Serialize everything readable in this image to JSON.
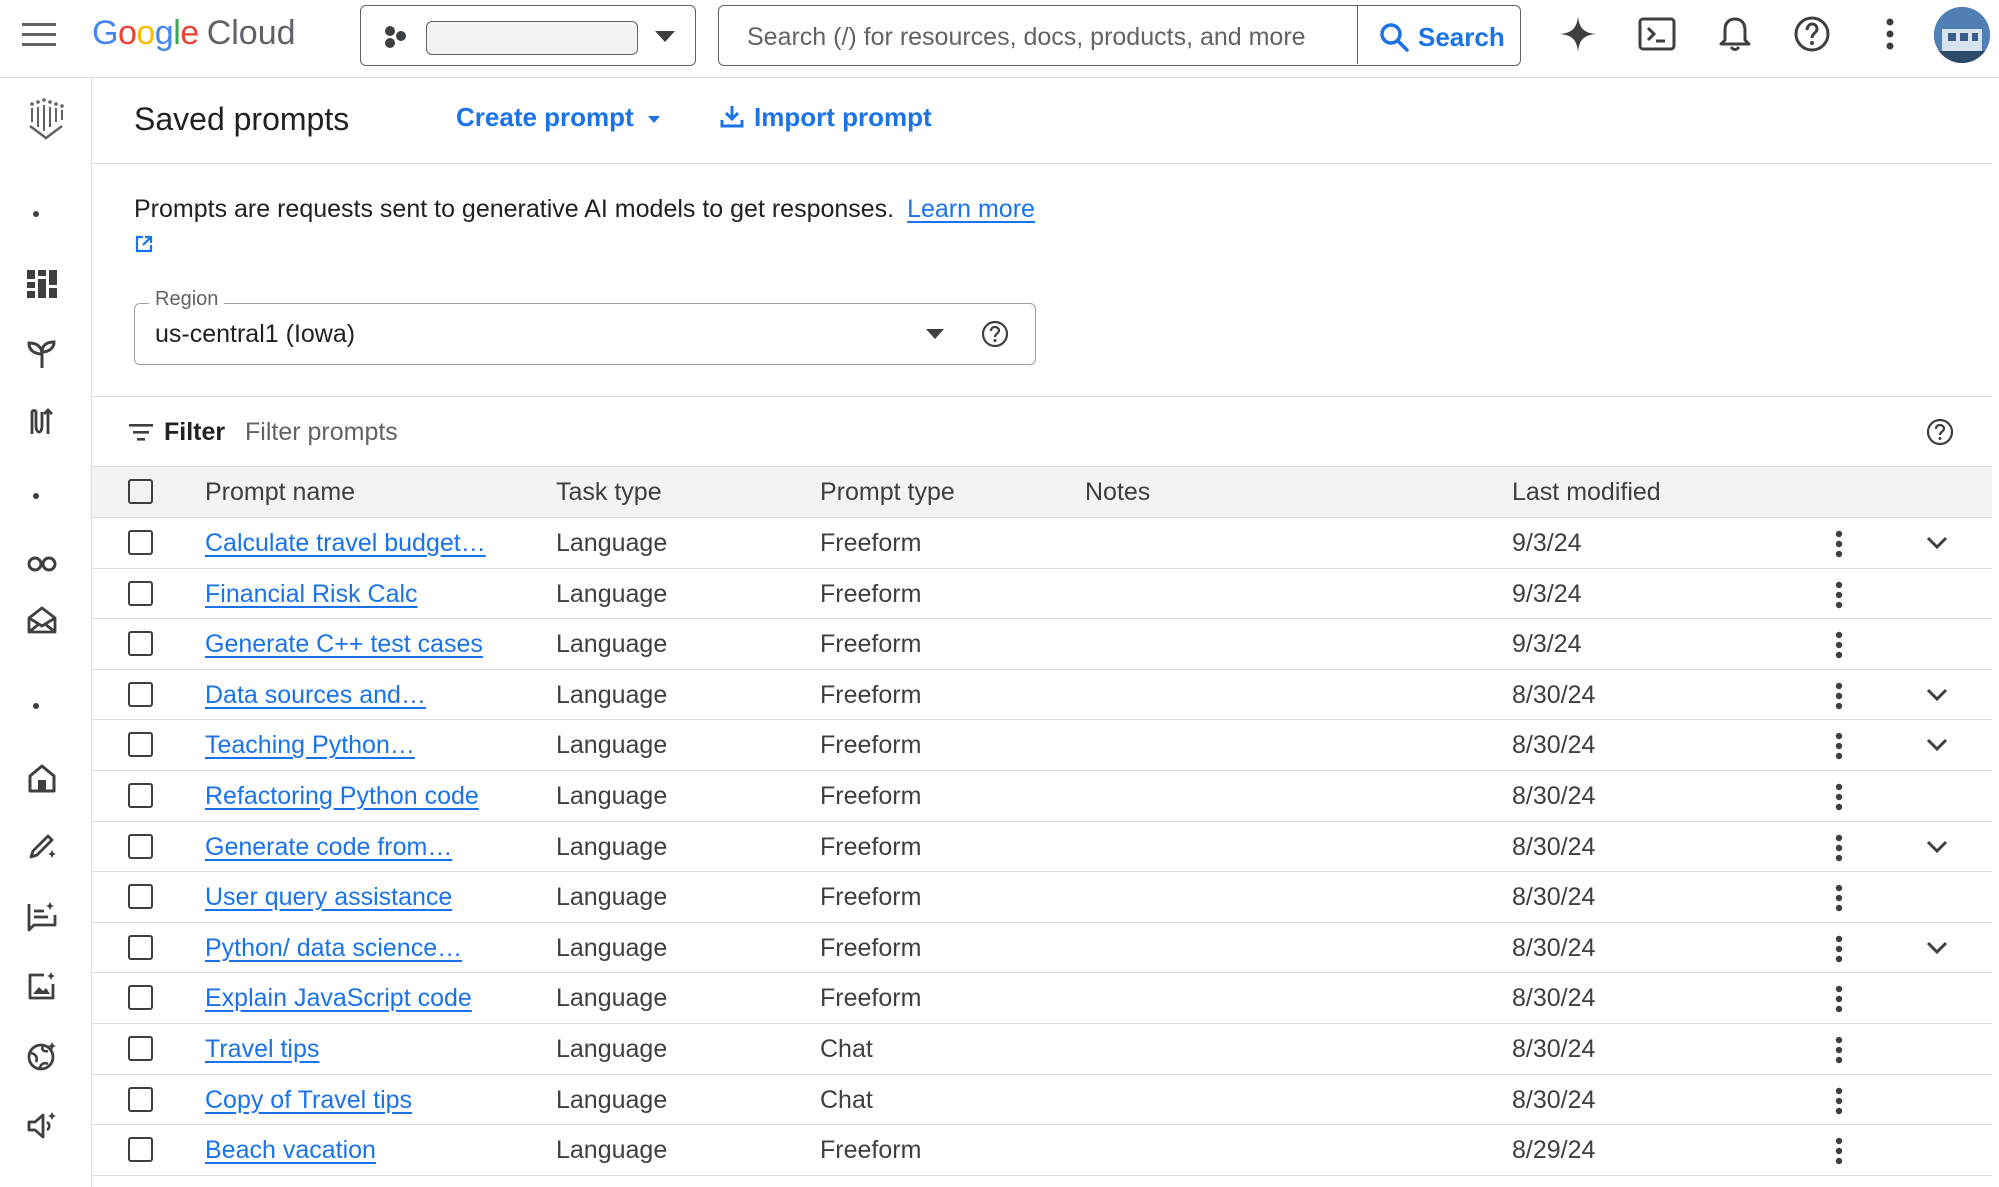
{
  "app": {
    "logo_google": "Google",
    "logo_cloud": "Cloud",
    "search_placeholder": "Search (/) for resources, docs, products, and more",
    "search_button": "Search"
  },
  "header": {
    "title": "Saved prompts",
    "create_prompt": "Create prompt",
    "import_prompt": "Import prompt"
  },
  "intro": {
    "text": "Prompts are requests sent to generative AI models to get responses.",
    "learn_more": "Learn more"
  },
  "region": {
    "label": "Region",
    "value": "us-central1 (Iowa)"
  },
  "filter": {
    "label": "Filter",
    "placeholder": "Filter prompts"
  },
  "table": {
    "columns": {
      "name": "Prompt name",
      "task": "Task type",
      "ptype": "Prompt type",
      "notes": "Notes",
      "modified": "Last modified"
    },
    "rows": [
      {
        "name": "Calculate travel budget…",
        "task": "Language",
        "ptype": "Freeform",
        "notes": "",
        "modified": "9/3/24",
        "expandable": true
      },
      {
        "name": "Financial Risk Calc",
        "task": "Language",
        "ptype": "Freeform",
        "notes": "",
        "modified": "9/3/24",
        "expandable": false
      },
      {
        "name": "Generate C++ test cases",
        "task": "Language",
        "ptype": "Freeform",
        "notes": "",
        "modified": "9/3/24",
        "expandable": false
      },
      {
        "name": "Data sources and…",
        "task": "Language",
        "ptype": "Freeform",
        "notes": "",
        "modified": "8/30/24",
        "expandable": true
      },
      {
        "name": "Teaching Python…",
        "task": "Language",
        "ptype": "Freeform",
        "notes": "",
        "modified": "8/30/24",
        "expandable": true
      },
      {
        "name": "Refactoring Python code",
        "task": "Language",
        "ptype": "Freeform",
        "notes": "",
        "modified": "8/30/24",
        "expandable": false
      },
      {
        "name": "Generate code from…",
        "task": "Language",
        "ptype": "Freeform",
        "notes": "",
        "modified": "8/30/24",
        "expandable": true
      },
      {
        "name": "User query assistance",
        "task": "Language",
        "ptype": "Freeform",
        "notes": "",
        "modified": "8/30/24",
        "expandable": false
      },
      {
        "name": "Python/ data science…",
        "task": "Language",
        "ptype": "Freeform",
        "notes": "",
        "modified": "8/30/24",
        "expandable": true
      },
      {
        "name": "Explain JavaScript code",
        "task": "Language",
        "ptype": "Freeform",
        "notes": "",
        "modified": "8/30/24",
        "expandable": false
      },
      {
        "name": "Travel tips",
        "task": "Language",
        "ptype": "Chat",
        "notes": "",
        "modified": "8/30/24",
        "expandable": false
      },
      {
        "name": "Copy of Travel tips",
        "task": "Language",
        "ptype": "Chat",
        "notes": "",
        "modified": "8/30/24",
        "expandable": false
      },
      {
        "name": "Beach vacation",
        "task": "Language",
        "ptype": "Freeform",
        "notes": "",
        "modified": "8/29/24",
        "expandable": false
      }
    ]
  },
  "colors": {
    "accent": "#1a73e8",
    "text": "#202124",
    "muted": "#5f6368",
    "divider": "#dadce0",
    "header_bg": "#f1f3f4"
  }
}
